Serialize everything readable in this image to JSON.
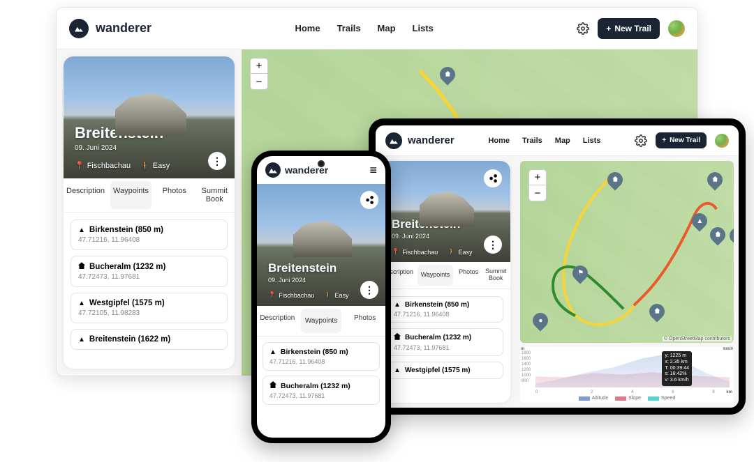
{
  "app": {
    "brand": "wanderer",
    "nav": {
      "home": "Home",
      "trails": "Trails",
      "map": "Map",
      "lists": "Lists"
    },
    "new_trail": "New Trail"
  },
  "trail": {
    "title": "Breitenstein",
    "date": "09. Juni 2024",
    "location": "Fischbachau",
    "difficulty": "Easy"
  },
  "tabs": {
    "description": "Description",
    "waypoints": "Waypoints",
    "photos": "Photos",
    "summit_book": "Summit\nBook"
  },
  "waypoints": [
    {
      "icon": "peak",
      "name": "Birkenstein (850 m)",
      "coords": "47.71216, 11.96408"
    },
    {
      "icon": "home",
      "name": "Bucheralm (1232 m)",
      "coords": "47.72473, 11.97681"
    },
    {
      "icon": "peak",
      "name": "Westgipfel (1575 m)",
      "coords": "47.72105, 11.98283"
    },
    {
      "icon": "peak",
      "name": "Breitenstein (1622 m)",
      "coords": ""
    }
  ],
  "map": {
    "zoom_in": "+",
    "zoom_out": "−",
    "osm_attr": "© OpenStreetMap contributors"
  },
  "elevation_tooltip": {
    "y": "y: 1225 m",
    "x": "x: 2.35 km",
    "t": "T: 00:39:44",
    "s": "s: 18.42%",
    "v": "v: 3.6 km/h"
  },
  "chart_data": {
    "type": "area",
    "title": "",
    "xlabel": "km",
    "ylabel": "m",
    "y2label": "km/h",
    "x": [
      0,
      2,
      4,
      6,
      8
    ],
    "ylim": [
      800,
      1800
    ],
    "yticks": [
      800,
      1000,
      1200,
      1400,
      1600,
      1800
    ],
    "y2lim": [
      -8,
      8
    ],
    "y2ticks": [
      -8,
      -4,
      0,
      4,
      8
    ],
    "series": [
      {
        "name": "Altitude",
        "color": "#7c9bd6",
        "values": [
          850,
          900,
          1000,
          1150,
          1300,
          1500,
          1622,
          1450,
          1100,
          900
        ]
      },
      {
        "name": "Slope",
        "color": "#de7b8a",
        "values": [
          5,
          8,
          12,
          16,
          18,
          14,
          0,
          -14,
          -18,
          -8
        ]
      },
      {
        "name": "Speed",
        "color": "#53d6d0",
        "values": [
          3.5,
          3.6,
          3.4,
          3.2,
          3.0,
          3.1,
          3.3,
          4.2,
          4.8,
          4.0
        ]
      }
    ],
    "legend": {
      "altitude": "Altitude",
      "slope": "Slope",
      "speed": "Speed"
    }
  }
}
